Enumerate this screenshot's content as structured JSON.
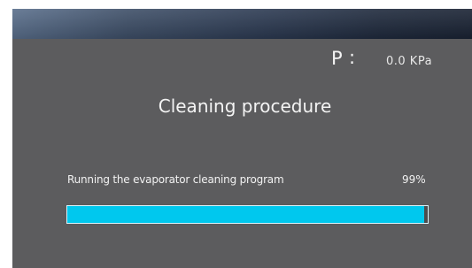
{
  "pressure": {
    "symbol": "P",
    "colon": ":",
    "value": "0.0 KPa"
  },
  "title": "Cleaning procedure",
  "progress": {
    "status_text": "Running the evaporator cleaning program",
    "percent_label": "99%",
    "percent": 99,
    "fill_color": "#00c8ee"
  },
  "colors": {
    "screen_background": "#5c5c5e",
    "header_gradient_start": "#5a6f8c",
    "header_gradient_end": "#1a2334",
    "text": "#f4f4f4"
  }
}
